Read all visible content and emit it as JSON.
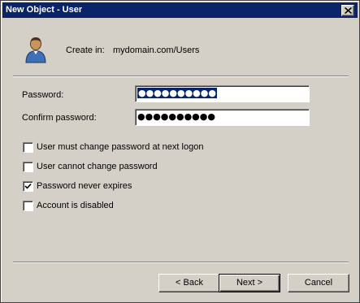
{
  "window": {
    "title": "New Object - User"
  },
  "header": {
    "create_in_label": "Create in:",
    "create_in_value": "mydomain.com/Users",
    "icon": "user-icon"
  },
  "fields": {
    "password": {
      "label": "Password:",
      "value": "●●●●●●●●●●"
    },
    "confirm_password": {
      "label": "Confirm password:",
      "value": "●●●●●●●●●●"
    }
  },
  "options": [
    {
      "label": "User must change password at next logon",
      "checked": false
    },
    {
      "label": "User cannot change password",
      "checked": false
    },
    {
      "label": "Password never expires",
      "checked": true
    },
    {
      "label": "Account is disabled",
      "checked": false
    }
  ],
  "buttons": {
    "back": "< Back",
    "next": "Next >",
    "cancel": "Cancel"
  },
  "colors": {
    "titlebar": "#0a246a",
    "face": "#d4d0c8"
  }
}
